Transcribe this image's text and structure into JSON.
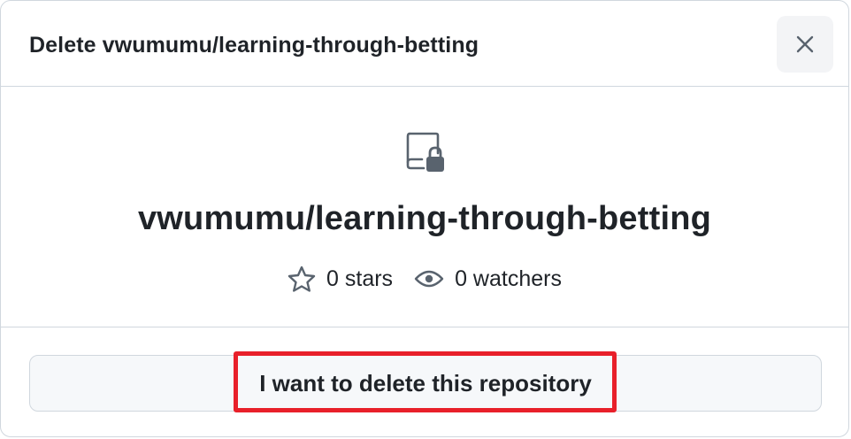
{
  "dialog": {
    "title": "Delete vwumumu/learning-through-betting",
    "close_icon": "close-icon"
  },
  "repo": {
    "icon": "repo-locked-icon",
    "full_name": "vwumumu/learning-through-betting",
    "stars_icon": "star-icon",
    "stars": "0 stars",
    "watchers_icon": "eye-icon",
    "watchers": "0 watchers"
  },
  "footer": {
    "delete_label": "I want to delete this repository",
    "highlight_color": "#e8202a"
  }
}
